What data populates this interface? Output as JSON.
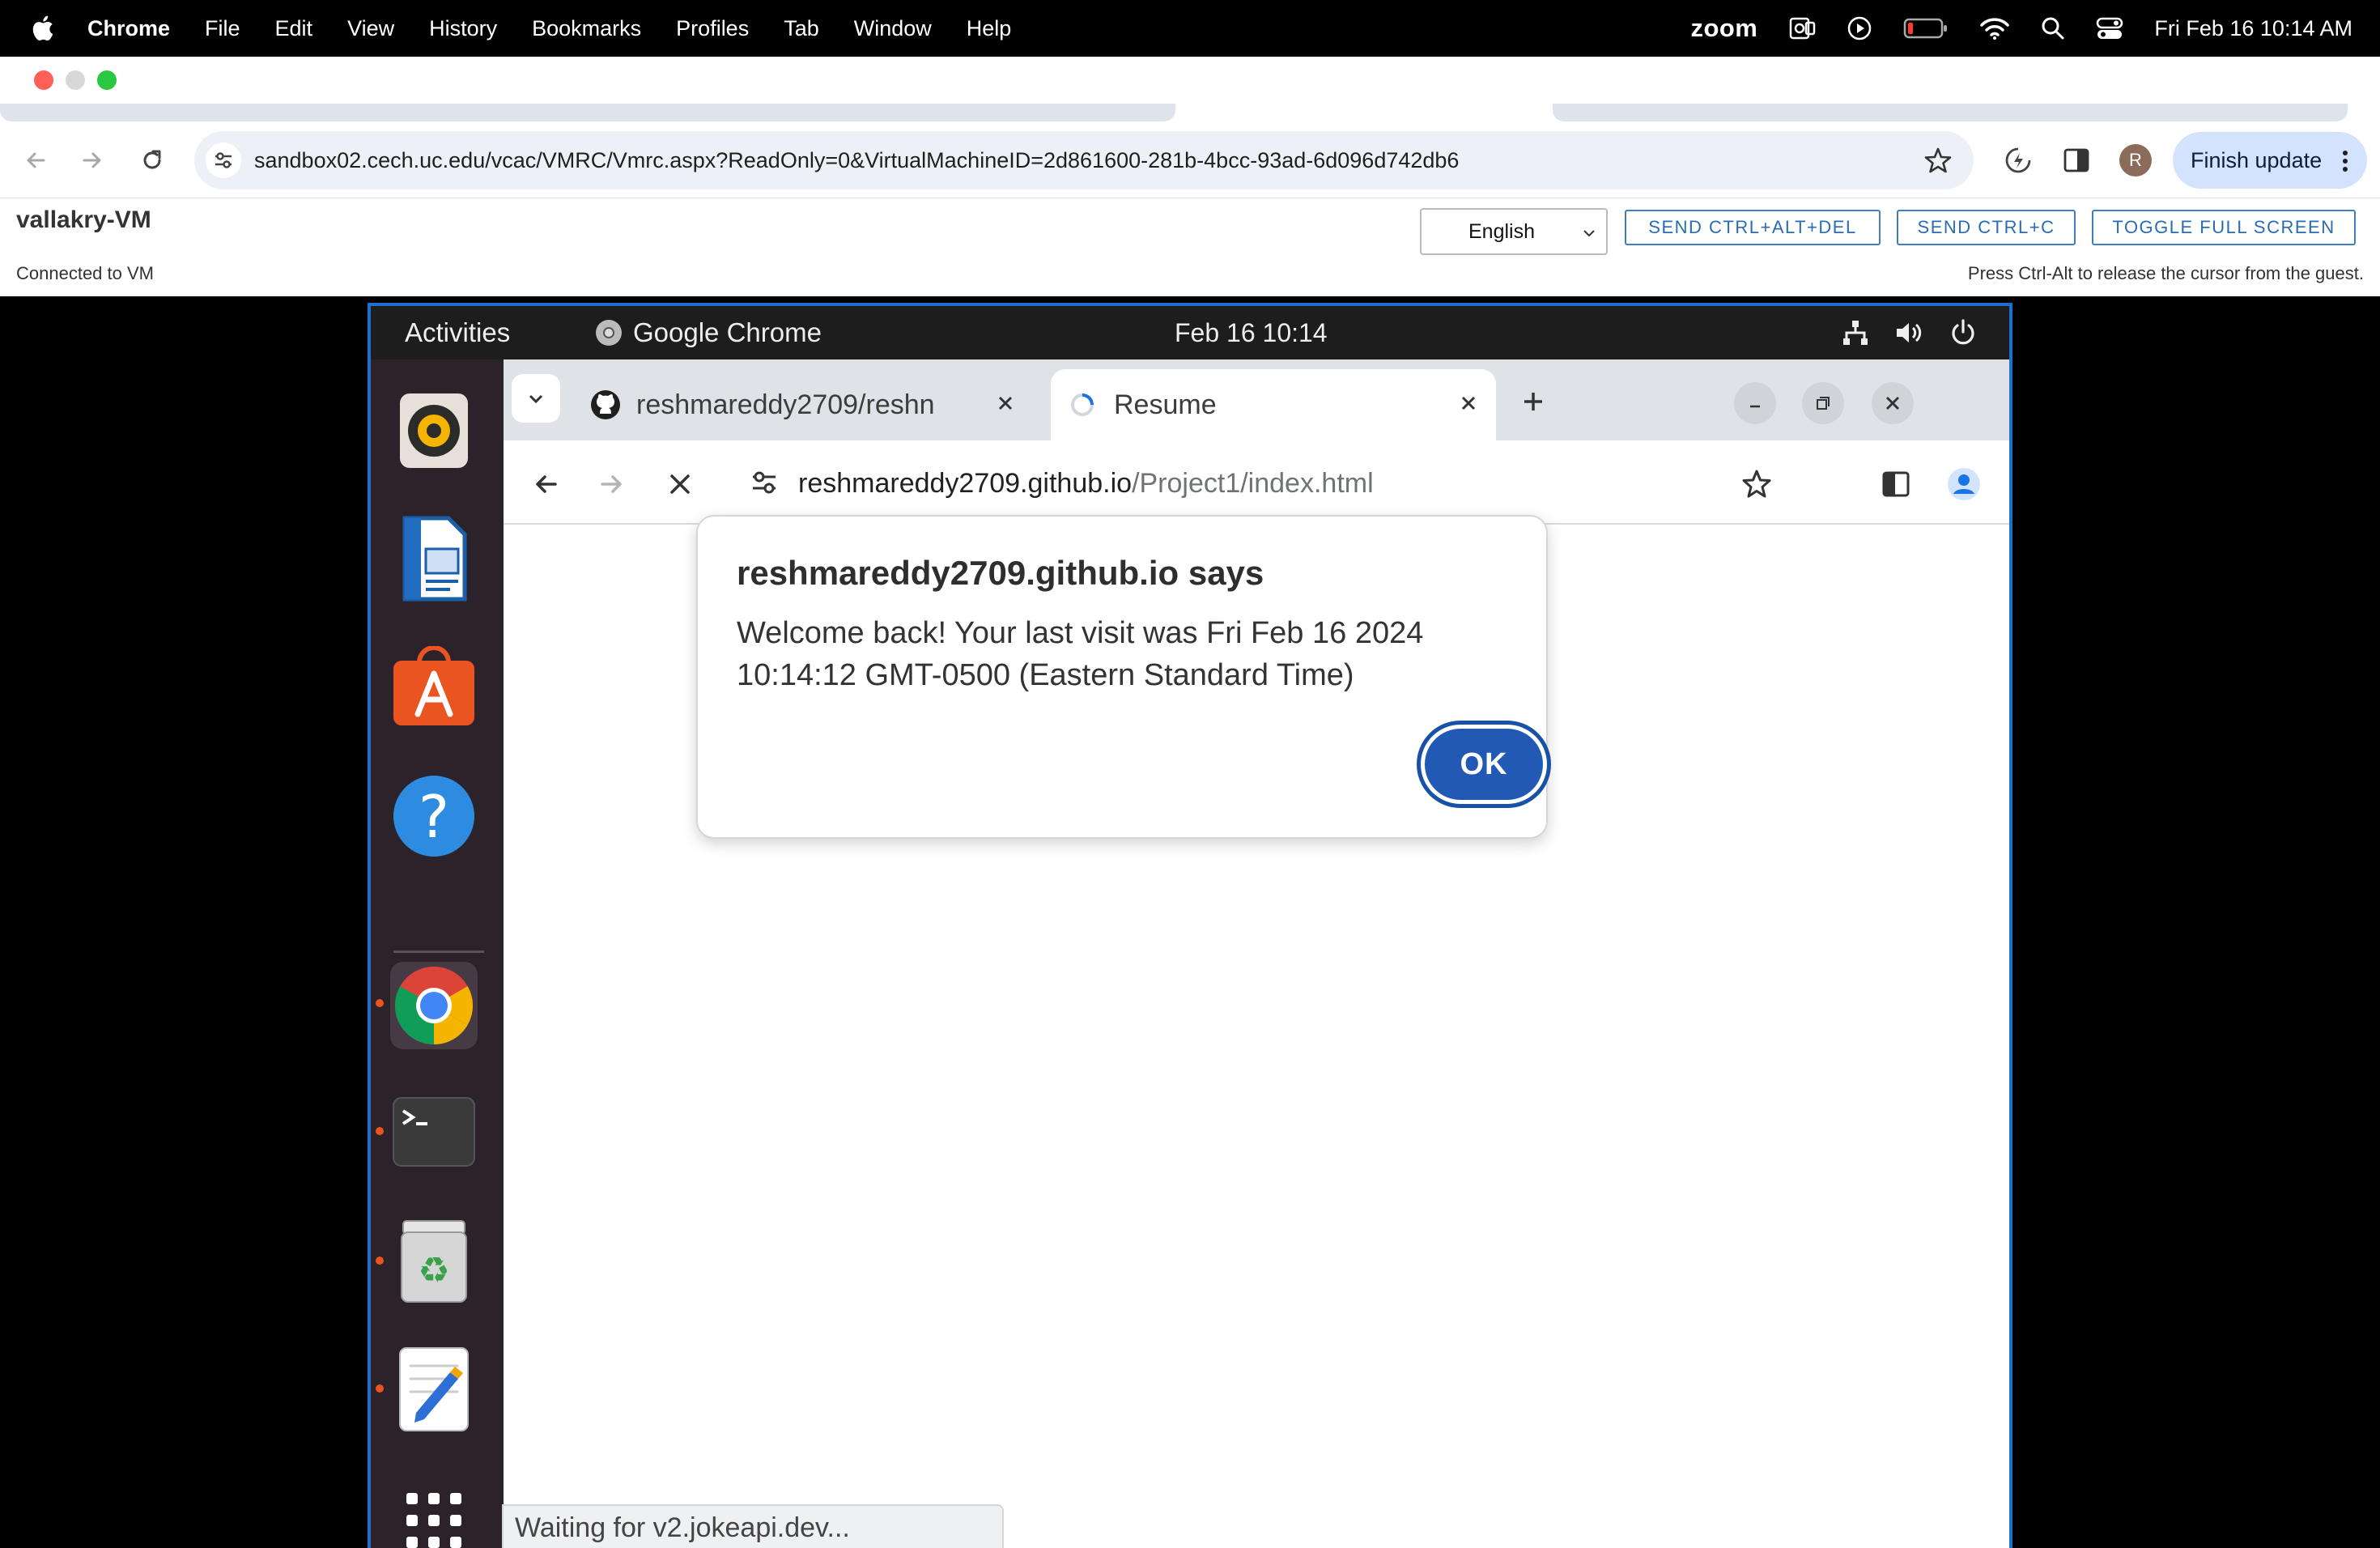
{
  "mac_menubar": {
    "app_name": "Chrome",
    "menus": [
      "File",
      "Edit",
      "View",
      "History",
      "Bookmarks",
      "Profiles",
      "Tab",
      "Window",
      "Help"
    ],
    "zoom_label": "zoom",
    "clock": "Fri Feb 16  10:14 AM",
    "status_icons": [
      "zoom-outlook-icon",
      "play-circle-icon",
      "battery-low-icon",
      "wifi-icon",
      "spotlight-search-icon",
      "control-center-icon"
    ]
  },
  "host_browser": {
    "url": "sandbox02.cech.uc.edu/vcac/VMRC/Vmrc.aspx?ReadOnly=0&VirtualMachineID=2d861600-281b-4bcc-93ad-6d096d742db6",
    "profile_initial": "R",
    "finish_update_label": "Finish update",
    "accent_color": "#d3e3fd"
  },
  "vmrc": {
    "vm_name": "vallakry-VM",
    "status": "Connected to VM",
    "language_selected": "English",
    "buttons": {
      "ctrl_alt_del": "SEND CTRL+ALT+DEL",
      "ctrl_c": "SEND CTRL+C",
      "full_screen": "TOGGLE FULL SCREEN"
    },
    "release_hint": "Press Ctrl-Alt to release the cursor from the guest."
  },
  "guest": {
    "topbar": {
      "activities": "Activities",
      "app_name": "Google Chrome",
      "clock": "Feb 16  10:14"
    },
    "dock": [
      "rhythmbox-icon",
      "libreoffice-impress-icon",
      "ubuntu-software-icon",
      "help-icon",
      "chrome-icon",
      "terminal-icon",
      "trash-icon",
      "text-editor-icon",
      "show-apps-icon"
    ],
    "browser": {
      "tabs": [
        {
          "title": "reshmareddy2709/reshn"
        },
        {
          "title": "Resume"
        }
      ],
      "url_host": "reshmareddy2709.github.io",
      "url_path": "/Project1/index.html",
      "status_text": "Waiting for v2.jokeapi.dev..."
    },
    "alert": {
      "title": "reshmareddy2709.github.io says",
      "message": "Welcome back! Your last visit was Fri Feb 16 2024 10:14:12 GMT-0500 (Eastern Standard Time)",
      "ok_label": "OK",
      "button_color": "#2159b5"
    }
  }
}
